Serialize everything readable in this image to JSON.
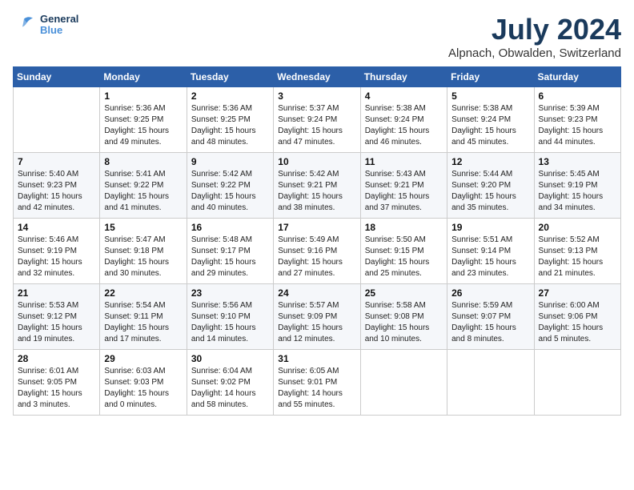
{
  "logo": {
    "line1": "General",
    "line2": "Blue"
  },
  "title": "July 2024",
  "subtitle": "Alpnach, Obwalden, Switzerland",
  "days_of_week": [
    "Sunday",
    "Monday",
    "Tuesday",
    "Wednesday",
    "Thursday",
    "Friday",
    "Saturday"
  ],
  "weeks": [
    [
      {
        "num": "",
        "info": ""
      },
      {
        "num": "1",
        "info": "Sunrise: 5:36 AM\nSunset: 9:25 PM\nDaylight: 15 hours\nand 49 minutes."
      },
      {
        "num": "2",
        "info": "Sunrise: 5:36 AM\nSunset: 9:25 PM\nDaylight: 15 hours\nand 48 minutes."
      },
      {
        "num": "3",
        "info": "Sunrise: 5:37 AM\nSunset: 9:24 PM\nDaylight: 15 hours\nand 47 minutes."
      },
      {
        "num": "4",
        "info": "Sunrise: 5:38 AM\nSunset: 9:24 PM\nDaylight: 15 hours\nand 46 minutes."
      },
      {
        "num": "5",
        "info": "Sunrise: 5:38 AM\nSunset: 9:24 PM\nDaylight: 15 hours\nand 45 minutes."
      },
      {
        "num": "6",
        "info": "Sunrise: 5:39 AM\nSunset: 9:23 PM\nDaylight: 15 hours\nand 44 minutes."
      }
    ],
    [
      {
        "num": "7",
        "info": "Sunrise: 5:40 AM\nSunset: 9:23 PM\nDaylight: 15 hours\nand 42 minutes."
      },
      {
        "num": "8",
        "info": "Sunrise: 5:41 AM\nSunset: 9:22 PM\nDaylight: 15 hours\nand 41 minutes."
      },
      {
        "num": "9",
        "info": "Sunrise: 5:42 AM\nSunset: 9:22 PM\nDaylight: 15 hours\nand 40 minutes."
      },
      {
        "num": "10",
        "info": "Sunrise: 5:42 AM\nSunset: 9:21 PM\nDaylight: 15 hours\nand 38 minutes."
      },
      {
        "num": "11",
        "info": "Sunrise: 5:43 AM\nSunset: 9:21 PM\nDaylight: 15 hours\nand 37 minutes."
      },
      {
        "num": "12",
        "info": "Sunrise: 5:44 AM\nSunset: 9:20 PM\nDaylight: 15 hours\nand 35 minutes."
      },
      {
        "num": "13",
        "info": "Sunrise: 5:45 AM\nSunset: 9:19 PM\nDaylight: 15 hours\nand 34 minutes."
      }
    ],
    [
      {
        "num": "14",
        "info": "Sunrise: 5:46 AM\nSunset: 9:19 PM\nDaylight: 15 hours\nand 32 minutes."
      },
      {
        "num": "15",
        "info": "Sunrise: 5:47 AM\nSunset: 9:18 PM\nDaylight: 15 hours\nand 30 minutes."
      },
      {
        "num": "16",
        "info": "Sunrise: 5:48 AM\nSunset: 9:17 PM\nDaylight: 15 hours\nand 29 minutes."
      },
      {
        "num": "17",
        "info": "Sunrise: 5:49 AM\nSunset: 9:16 PM\nDaylight: 15 hours\nand 27 minutes."
      },
      {
        "num": "18",
        "info": "Sunrise: 5:50 AM\nSunset: 9:15 PM\nDaylight: 15 hours\nand 25 minutes."
      },
      {
        "num": "19",
        "info": "Sunrise: 5:51 AM\nSunset: 9:14 PM\nDaylight: 15 hours\nand 23 minutes."
      },
      {
        "num": "20",
        "info": "Sunrise: 5:52 AM\nSunset: 9:13 PM\nDaylight: 15 hours\nand 21 minutes."
      }
    ],
    [
      {
        "num": "21",
        "info": "Sunrise: 5:53 AM\nSunset: 9:12 PM\nDaylight: 15 hours\nand 19 minutes."
      },
      {
        "num": "22",
        "info": "Sunrise: 5:54 AM\nSunset: 9:11 PM\nDaylight: 15 hours\nand 17 minutes."
      },
      {
        "num": "23",
        "info": "Sunrise: 5:56 AM\nSunset: 9:10 PM\nDaylight: 15 hours\nand 14 minutes."
      },
      {
        "num": "24",
        "info": "Sunrise: 5:57 AM\nSunset: 9:09 PM\nDaylight: 15 hours\nand 12 minutes."
      },
      {
        "num": "25",
        "info": "Sunrise: 5:58 AM\nSunset: 9:08 PM\nDaylight: 15 hours\nand 10 minutes."
      },
      {
        "num": "26",
        "info": "Sunrise: 5:59 AM\nSunset: 9:07 PM\nDaylight: 15 hours\nand 8 minutes."
      },
      {
        "num": "27",
        "info": "Sunrise: 6:00 AM\nSunset: 9:06 PM\nDaylight: 15 hours\nand 5 minutes."
      }
    ],
    [
      {
        "num": "28",
        "info": "Sunrise: 6:01 AM\nSunset: 9:05 PM\nDaylight: 15 hours\nand 3 minutes."
      },
      {
        "num": "29",
        "info": "Sunrise: 6:03 AM\nSunset: 9:03 PM\nDaylight: 15 hours\nand 0 minutes."
      },
      {
        "num": "30",
        "info": "Sunrise: 6:04 AM\nSunset: 9:02 PM\nDaylight: 14 hours\nand 58 minutes."
      },
      {
        "num": "31",
        "info": "Sunrise: 6:05 AM\nSunset: 9:01 PM\nDaylight: 14 hours\nand 55 minutes."
      },
      {
        "num": "",
        "info": ""
      },
      {
        "num": "",
        "info": ""
      },
      {
        "num": "",
        "info": ""
      }
    ]
  ]
}
